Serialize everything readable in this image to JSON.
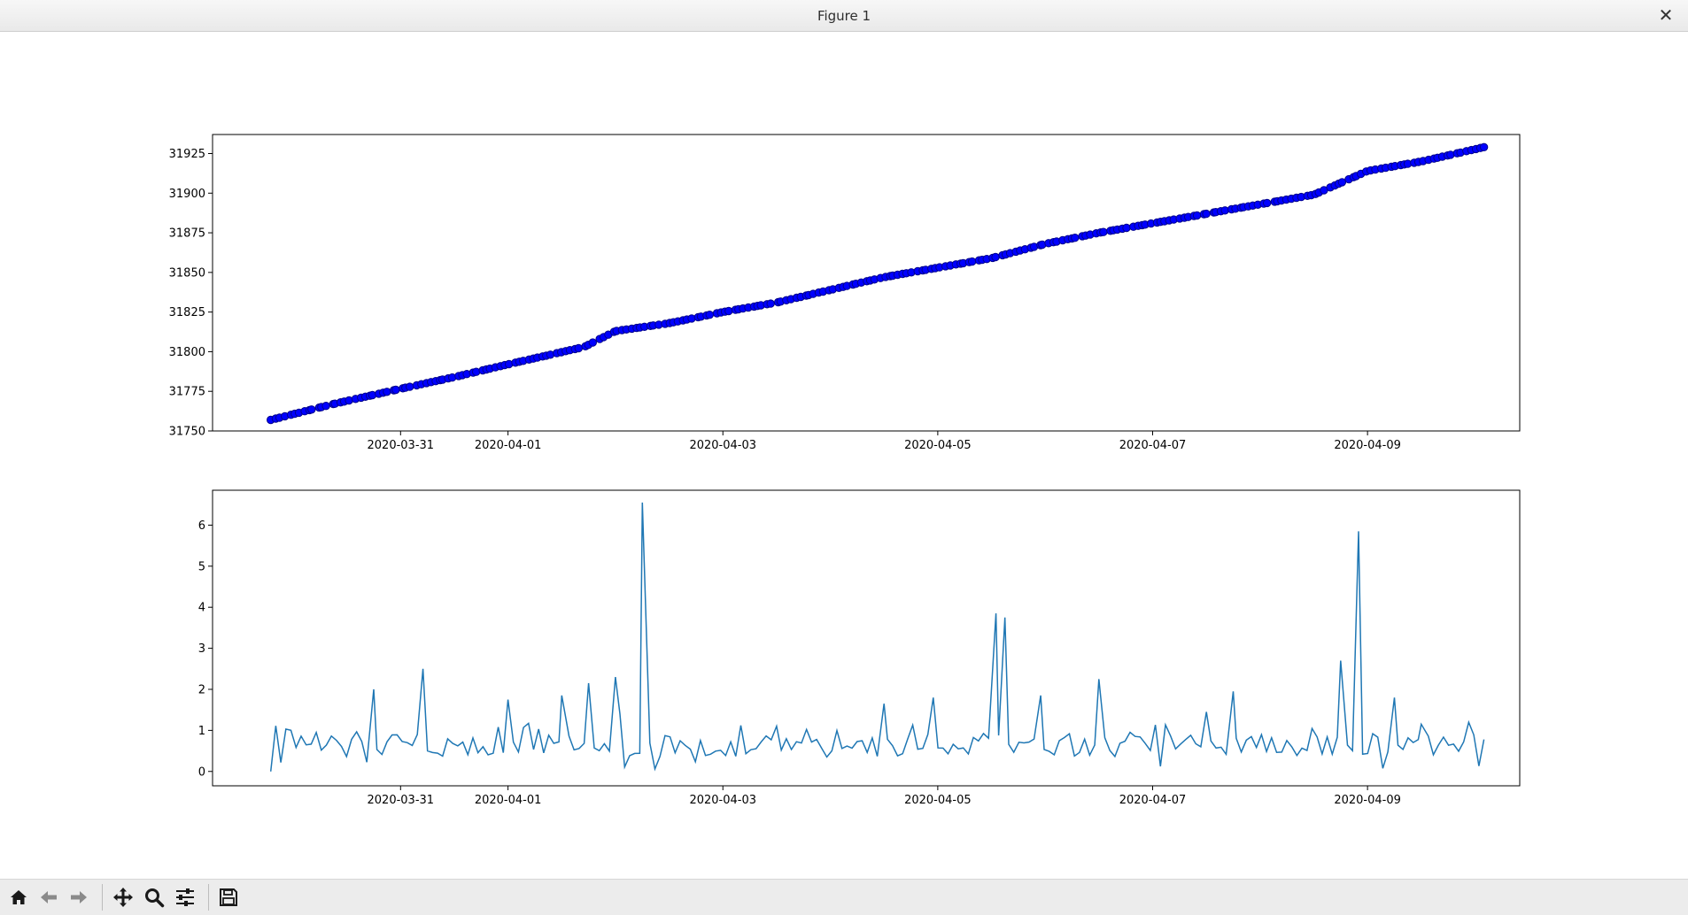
{
  "window": {
    "title": "Figure 1",
    "close_glyph": "✕"
  },
  "toolbar": {
    "buttons": [
      {
        "name": "home-icon"
      },
      {
        "name": "back-arrow-icon"
      },
      {
        "name": "forward-arrow-icon"
      },
      {
        "name": "pan-icon"
      },
      {
        "name": "zoom-icon"
      },
      {
        "name": "configure-subplots-icon"
      },
      {
        "name": "save-icon"
      }
    ]
  },
  "colors": {
    "marker": "#0000ff",
    "marker_edge": "#00008b",
    "top_line": "#000000",
    "bottom_line": "#1f77b4"
  },
  "chart_data": [
    {
      "type": "line",
      "title": "",
      "xlabel": "",
      "ylabel": "",
      "markers": true,
      "marker_color": "blue",
      "line_color": "black",
      "x_tick_labels": [
        "2020-03-31",
        "2020-04-01",
        "2020-04-03",
        "2020-04-05",
        "2020-04-07",
        "2020-04-09"
      ],
      "x_tick_dates": [
        "2020-03-31",
        "2020-04-01",
        "2020-04-03",
        "2020-04-05",
        "2020-04-07",
        "2020-04-09"
      ],
      "y_ticks": [
        31750,
        31775,
        31800,
        31825,
        31850,
        31875,
        31900,
        31925
      ],
      "xlim": [
        "2020-03-29 06:00",
        "2020-04-10 10:00"
      ],
      "ylim": [
        31750,
        31937
      ],
      "grid": false,
      "series": [
        {
          "anchors": [
            [
              "2020-03-29 19:00",
              31757
            ],
            [
              "2020-03-30 09:00",
              31767
            ],
            [
              "2020-03-30 23:00",
              31776
            ],
            [
              "2020-03-31 12:00",
              31784
            ],
            [
              "2020-04-01 00:00",
              31792
            ],
            [
              "2020-04-01 17:00",
              31803
            ],
            [
              "2020-04-02 00:00",
              31813
            ],
            [
              "2020-04-02 12:00",
              31818
            ],
            [
              "2020-04-03 00:00",
              31825
            ],
            [
              "2020-04-03 12:00",
              31831
            ],
            [
              "2020-04-04 00:00",
              31839
            ],
            [
              "2020-04-04 12:00",
              31847
            ],
            [
              "2020-04-05 00:00",
              31853
            ],
            [
              "2020-04-05 12:00",
              31859
            ],
            [
              "2020-04-06 00:00",
              31868
            ],
            [
              "2020-04-06 12:00",
              31875
            ],
            [
              "2020-04-07 00:00",
              31881
            ],
            [
              "2020-04-07 12:00",
              31887
            ],
            [
              "2020-04-08 00:00",
              31893
            ],
            [
              "2020-04-08 12:00",
              31899
            ],
            [
              "2020-04-09 00:00",
              31914
            ],
            [
              "2020-04-09 12:00",
              31920
            ],
            [
              "2020-04-10 02:00",
              31929
            ]
          ],
          "n_points": 260
        }
      ]
    },
    {
      "type": "line",
      "title": "",
      "xlabel": "",
      "ylabel": "",
      "line_color": "#1f77b4",
      "x_tick_labels": [
        "2020-03-31",
        "2020-04-01",
        "2020-04-03",
        "2020-04-05",
        "2020-04-07",
        "2020-04-09"
      ],
      "x_tick_dates": [
        "2020-03-31",
        "2020-04-01",
        "2020-04-03",
        "2020-04-05",
        "2020-04-07",
        "2020-04-09"
      ],
      "y_ticks": [
        0,
        1,
        2,
        3,
        4,
        5,
        6
      ],
      "y_tick_labels": [
        "0",
        "1",
        "2",
        "3",
        "4",
        "5",
        "6"
      ],
      "xlim": [
        "2020-03-29 06:00",
        "2020-04-10 10:00"
      ],
      "ylim": [
        -0.35,
        6.85
      ],
      "grid": false,
      "spikes": [
        [
          "2020-03-30 18:00",
          2.0
        ],
        [
          "2020-03-31 05:00",
          2.5
        ],
        [
          "2020-04-01 00:00",
          1.75
        ],
        [
          "2020-04-01 12:00",
          1.85
        ],
        [
          "2020-04-01 18:00",
          2.15
        ],
        [
          "2020-04-02 00:00",
          2.3
        ],
        [
          "2020-04-02 01:00",
          1.4
        ],
        [
          "2020-04-02 06:00",
          6.55
        ],
        [
          "2020-04-03 12:00",
          1.1
        ],
        [
          "2020-04-04 12:00",
          1.65
        ],
        [
          "2020-04-04 23:00",
          1.8
        ],
        [
          "2020-04-05 13:00",
          3.85
        ],
        [
          "2020-04-05 15:00",
          3.75
        ],
        [
          "2020-04-05 23:00",
          1.85
        ],
        [
          "2020-04-06 12:00",
          2.25
        ],
        [
          "2020-04-07 12:00",
          1.45
        ],
        [
          "2020-04-07 18:00",
          1.95
        ],
        [
          "2020-04-08 18:00",
          2.7
        ],
        [
          "2020-04-08 22:00",
          5.85
        ],
        [
          "2020-04-09 06:00",
          1.8
        ],
        [
          "2020-04-09 12:00",
          1.15
        ]
      ],
      "end": [
        "2020-04-10 02:00",
        0.78
      ],
      "start": [
        "2020-03-29 19:00",
        0.0
      ]
    }
  ]
}
